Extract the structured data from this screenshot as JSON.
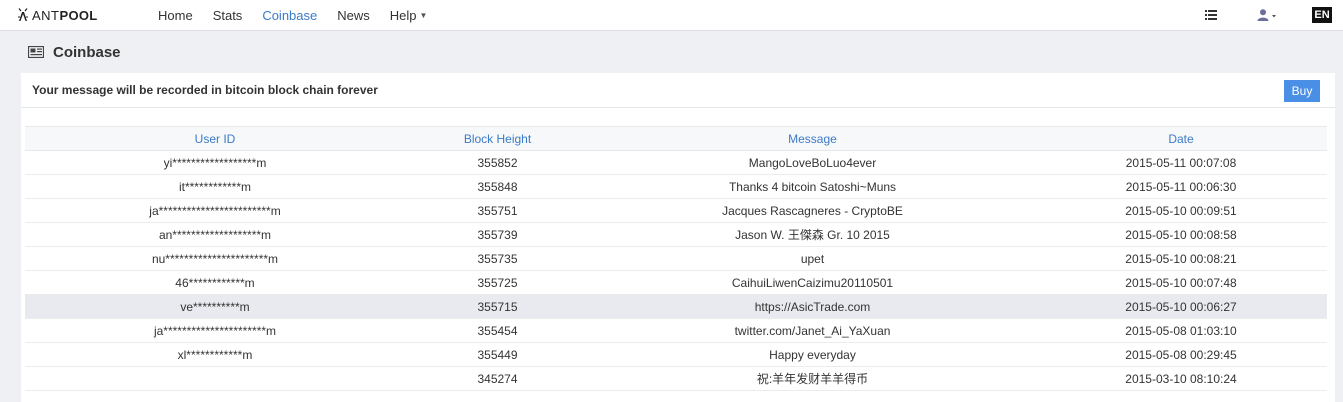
{
  "brand": {
    "name_part1": "ANT",
    "name_part2": "POOL"
  },
  "nav": {
    "items": [
      {
        "label": "Home"
      },
      {
        "label": "Stats"
      },
      {
        "label": "Coinbase"
      },
      {
        "label": "News"
      },
      {
        "label": "Help"
      }
    ],
    "active": "Coinbase"
  },
  "header_right": {
    "language": "EN"
  },
  "page": {
    "title": "Coinbase"
  },
  "panel": {
    "message": "Your message will be recorded in bitcoin block chain forever",
    "buy_label": "Buy"
  },
  "table": {
    "columns": [
      "User ID",
      "Block Height",
      "Message",
      "Date"
    ],
    "rows": [
      {
        "user": "yi******************m",
        "height": "355852",
        "message": "MangoLoveBoLuo4ever",
        "date": "2015-05-11 00:07:08"
      },
      {
        "user": "it************m",
        "height": "355848",
        "message": "Thanks 4 bitcoin Satoshi~Muns",
        "date": "2015-05-11 00:06:30"
      },
      {
        "user": "ja************************m",
        "height": "355751",
        "message": "Jacques Rascagneres - CryptoBE",
        "date": "2015-05-10 00:09:51"
      },
      {
        "user": "an*******************m",
        "height": "355739",
        "message": "Jason W. 王傑森 Gr. 10 2015",
        "date": "2015-05-10 00:08:58"
      },
      {
        "user": "nu**********************m",
        "height": "355735",
        "message": "upet",
        "date": "2015-05-10 00:08:21"
      },
      {
        "user": "46************m",
        "height": "355725",
        "message": "CaihuiLiwenCaizimu20110501",
        "date": "2015-05-10 00:07:48"
      },
      {
        "user": "ve**********m",
        "height": "355715",
        "message": "https://AsicTrade.com",
        "date": "2015-05-10 00:06:27"
      },
      {
        "user": "ja**********************m",
        "height": "355454",
        "message": "twitter.com/Janet_Ai_YaXuan",
        "date": "2015-05-08 01:03:10"
      },
      {
        "user": "xl************m",
        "height": "355449",
        "message": "Happy everyday",
        "date": "2015-05-08 00:29:45"
      },
      {
        "user": "",
        "height": "345274",
        "message": "祝:羊年发财羊羊得币",
        "date": "2015-03-10 08:10:24"
      }
    ],
    "highlighted_row": 6
  },
  "colors": {
    "accent": "#3a7bc8",
    "button": "#4a8fe6",
    "background": "#eef0f3"
  }
}
